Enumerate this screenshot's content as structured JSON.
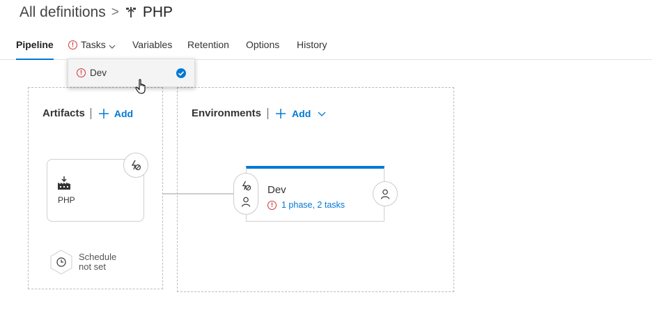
{
  "breadcrumb": {
    "parent": "All definitions",
    "separator": ">",
    "title": "PHP"
  },
  "tabs": [
    {
      "label": "Pipeline"
    },
    {
      "label": "Tasks"
    },
    {
      "label": "Variables"
    },
    {
      "label": "Retention"
    },
    {
      "label": "Options"
    },
    {
      "label": "History"
    }
  ],
  "tasks_dropdown": {
    "item_label": "Dev"
  },
  "artifacts": {
    "title": "Artifacts",
    "add_label": "Add",
    "artifact_name": "PHP",
    "schedule_line1": "Schedule",
    "schedule_line2": "not set"
  },
  "environments": {
    "title": "Environments",
    "add_label": "Add",
    "env_name": "Dev",
    "env_status": "1 phase, 2 tasks"
  },
  "colors": {
    "accent": "#0078d4",
    "error": "#d13438"
  },
  "icons": [
    "build-pipeline-icon",
    "warning-icon",
    "chevron-down-icon",
    "checkmark-icon",
    "hand-cursor-icon",
    "plus-icon",
    "artifact-factory-icon",
    "trigger-icon",
    "person-icon",
    "clock-icon"
  ]
}
